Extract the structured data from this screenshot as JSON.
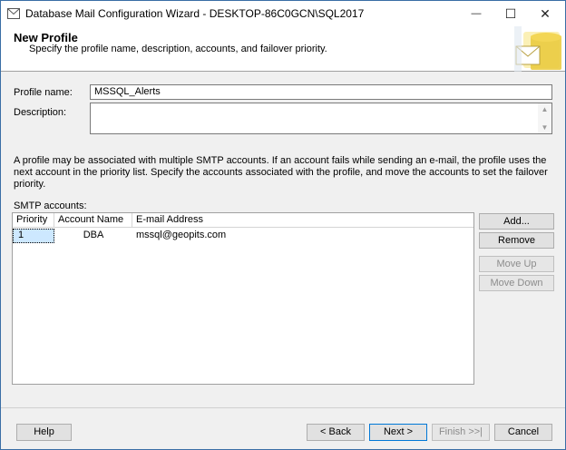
{
  "window": {
    "title": "Database Mail Configuration Wizard - DESKTOP-86C0GCN\\SQL2017",
    "controls": {
      "minimize": "—",
      "maximize": "☐",
      "close": "✕"
    }
  },
  "header": {
    "title": "New Profile",
    "subtitle": "Specify the profile name, description, accounts, and failover priority."
  },
  "form": {
    "profile_name_label": "Profile name:",
    "profile_name_value": "MSSQL_Alerts",
    "description_label": "Description:",
    "description_value": ""
  },
  "info_text": "A profile may be associated with multiple SMTP accounts. If an account fails while sending an e-mail, the profile uses the next account in the priority list. Specify the accounts associated with the profile, and move the accounts to set the failover priority.",
  "smtp": {
    "label": "SMTP accounts:",
    "columns": [
      "Priority",
      "Account Name",
      "E-mail Address"
    ],
    "rows": [
      {
        "priority": "1",
        "account": "DBA",
        "email": "mssql@geopits.com"
      }
    ]
  },
  "side_buttons": {
    "add": "Add...",
    "remove": "Remove",
    "move_up": "Move Up",
    "move_down": "Move Down"
  },
  "footer": {
    "help": "Help",
    "back": "< Back",
    "next": "Next >",
    "finish": "Finish >>|",
    "cancel": "Cancel"
  },
  "icons": {
    "title": "database-mail-icon",
    "header": "mail-wizard-graphic"
  }
}
